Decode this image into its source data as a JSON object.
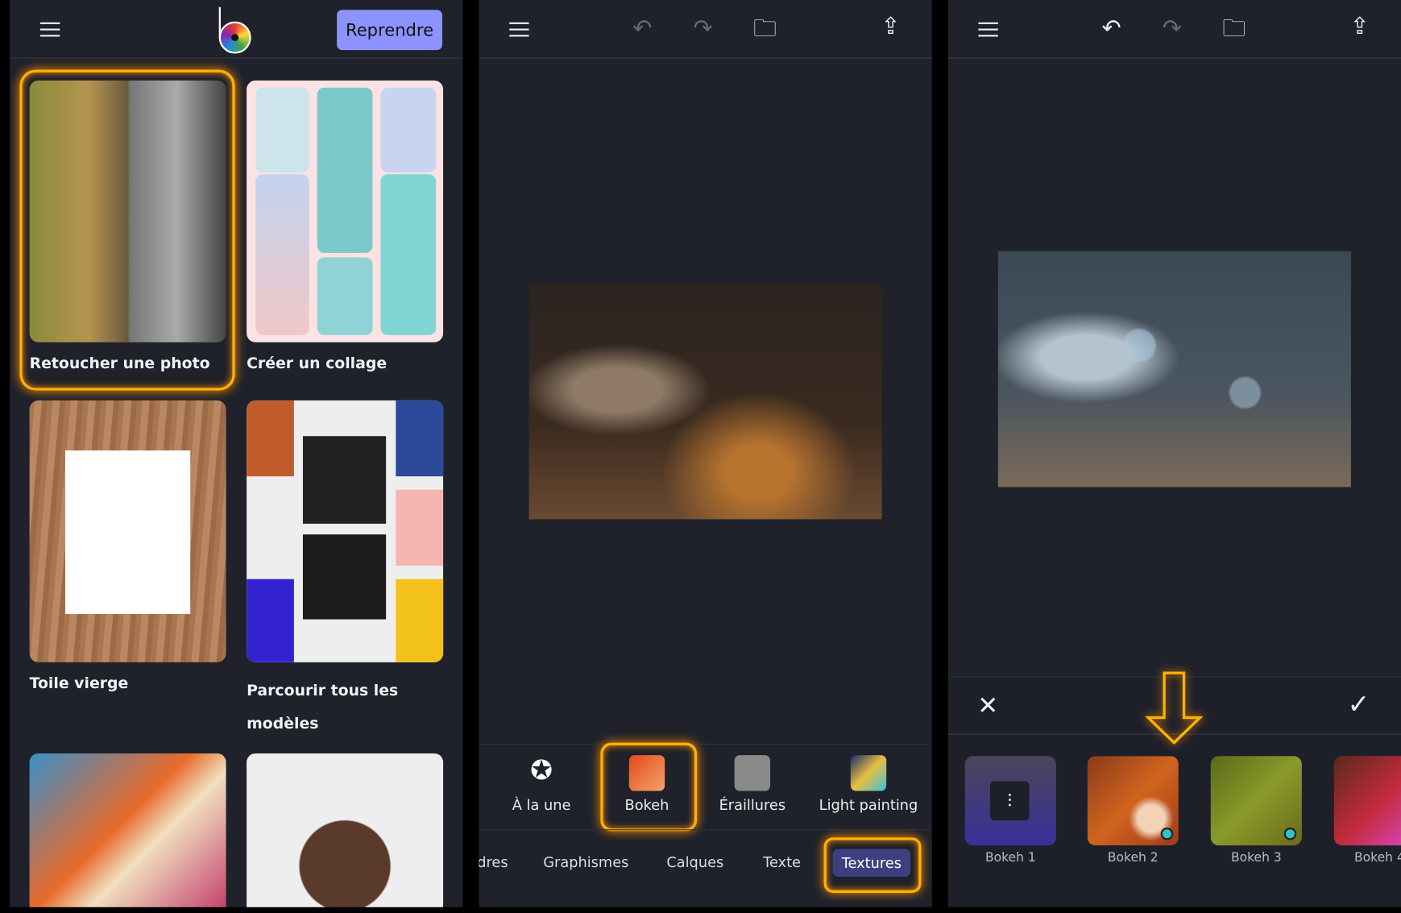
{
  "home": {
    "resume_button": "Reprendre",
    "cards": [
      {
        "label": "Retoucher une photo"
      },
      {
        "label": "Créer un collage"
      },
      {
        "label": "Toile vierge"
      },
      {
        "label": "Parcourir tous les modèles"
      }
    ]
  },
  "editor": {
    "tools": [
      {
        "label": "À la une"
      },
      {
        "label": "Bokeh"
      },
      {
        "label": "Éraillures"
      },
      {
        "label": "Light painting"
      }
    ],
    "tabs": [
      {
        "label": "dres"
      },
      {
        "label": "Graphismes"
      },
      {
        "label": "Calques"
      },
      {
        "label": "Texte"
      },
      {
        "label": "Textures"
      }
    ],
    "selected_tab": "Textures"
  },
  "bokeh_panel": {
    "presets": [
      {
        "label": "Bokeh 1"
      },
      {
        "label": "Bokeh 2"
      },
      {
        "label": "Bokeh 3"
      },
      {
        "label": "Bokeh 4"
      }
    ]
  },
  "colors": {
    "accent": "#8c93ff",
    "highlight": "#ffb300",
    "badge": "#2ec4c9"
  }
}
